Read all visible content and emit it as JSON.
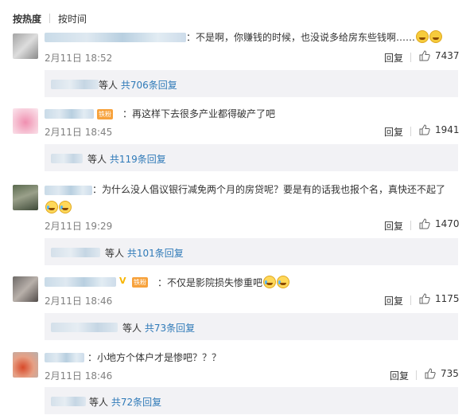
{
  "sort": {
    "hot_label": "按热度",
    "time_label": "按时间"
  },
  "comments": [
    {
      "text": "：不是啊，你赚钱的时候，也没说多给房东些钱啊……",
      "time": "2月11日 18:52",
      "reply_label": "回复",
      "likes": "7437",
      "replies_prefix": "等人",
      "replies_count": "共706条回复"
    },
    {
      "text": "：再这样下去很多产业都得破产了吧",
      "time": "2月11日 18:45",
      "reply_label": "回复",
      "likes": "1941",
      "replies_prefix": "等人",
      "replies_count": "共119条回复"
    },
    {
      "text": "：为什么没人倡议银行减免两个月的房贷呢？要是有的话我也报个名，真快还不起了",
      "time": "2月11日 19:29",
      "reply_label": "回复",
      "likes": "1470",
      "replies_prefix": "等人",
      "replies_count": "共101条回复"
    },
    {
      "text": "：不仅是影院损失惨重吧",
      "time": "2月11日 18:46",
      "reply_label": "回复",
      "likes": "1175",
      "replies_prefix": "等人",
      "replies_count": "共73条回复"
    },
    {
      "text": "：小地方个体户才是惨吧？？？",
      "time": "2月11日 18:46",
      "reply_label": "回复",
      "likes": "735",
      "replies_prefix": "等人",
      "replies_count": "共72条回复"
    }
  ],
  "badges": {
    "member_label": "铁粉",
    "verified_icon": "V"
  },
  "icons": {
    "like": "thumbs-up-icon",
    "emoji_laugh": "laugh-emoji-icon",
    "emoji_cry_laugh": "cry-laugh-emoji-icon"
  },
  "colors": {
    "link": "#2f7ab8",
    "reply_bg": "#f2f2f5",
    "muted": "#808080"
  }
}
